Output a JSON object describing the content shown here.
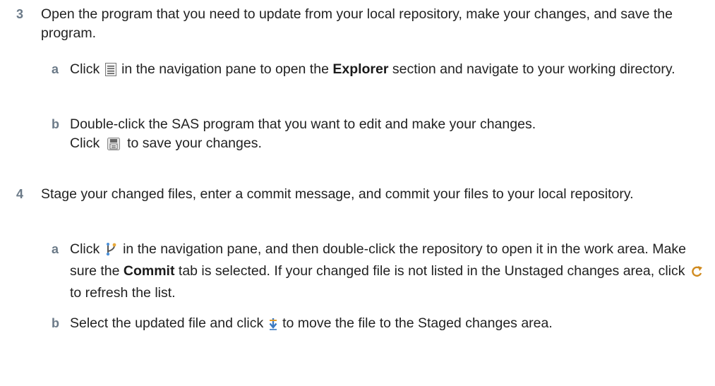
{
  "steps": [
    {
      "number": "3",
      "text": "Open the program that you need to update from your local repository, make your changes, and save the program.",
      "substeps": [
        {
          "letter": "a",
          "parts": {
            "p1": "Click",
            "icon": "explorer-icon",
            "p2": "in the navigation pane to open the",
            "bold": "Explorer",
            "p3": "section and navigate to your working directory."
          }
        },
        {
          "letter": "b",
          "parts": {
            "p1": "Double-click the SAS program that you want to edit and make your changes.",
            "p2": "Click",
            "icon": "save-icon",
            "p3": "to save your changes."
          }
        }
      ]
    },
    {
      "number": "4",
      "text": "Stage your changed files, enter a commit message, and commit your files to your local repository.",
      "substeps": [
        {
          "letter": "a",
          "parts": {
            "p1": "Click",
            "icon": "git-repository-icon",
            "p2": "in the navigation pane, and then double-click the repository to open it in the work area. Make sure the",
            "bold": "Commit",
            "p3": "tab is selected. If your changed file is not listed in the Unstaged changes area, click",
            "icon2": "refresh-icon",
            "p4": "to refresh the list."
          }
        },
        {
          "letter": "b",
          "parts": {
            "p1": "Select the updated file and click",
            "icon": "stage-arrow-icon",
            "p2": "to move the file to the Staged changes area."
          }
        }
      ]
    }
  ]
}
